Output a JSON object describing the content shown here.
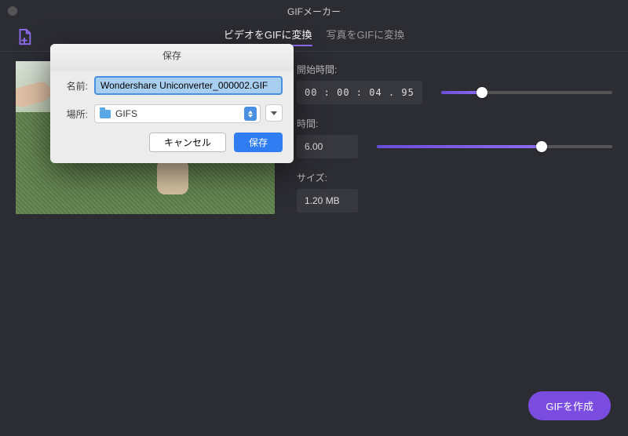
{
  "titlebar": {
    "title": "GIFメーカー"
  },
  "toolbar": {
    "tabs": [
      {
        "label": "ビデオをGIFに変換",
        "active": true
      },
      {
        "label": "写真をGIFに変換",
        "active": false
      }
    ]
  },
  "panel": {
    "start_label": "開始時間:",
    "start_value": "00 : 00 : 04 . 95",
    "duration_label": "時間:",
    "duration_value": "6.00",
    "size_label": "サイズ:",
    "size_value": "1.20 MB",
    "slider1_percent": 24,
    "slider2_percent": 70
  },
  "create_button": "GIFを作成",
  "dialog": {
    "title": "保存",
    "name_label": "名前:",
    "name_value": "Wondershare Uniconverter_000002.GIF",
    "location_label": "場所:",
    "location_value": "GIFS",
    "cancel": "キャンセル",
    "save": "保存"
  },
  "colors": {
    "accent": "#8e6cf0",
    "primary_button": "#7a4de0",
    "mac_blue": "#2f7df0"
  }
}
